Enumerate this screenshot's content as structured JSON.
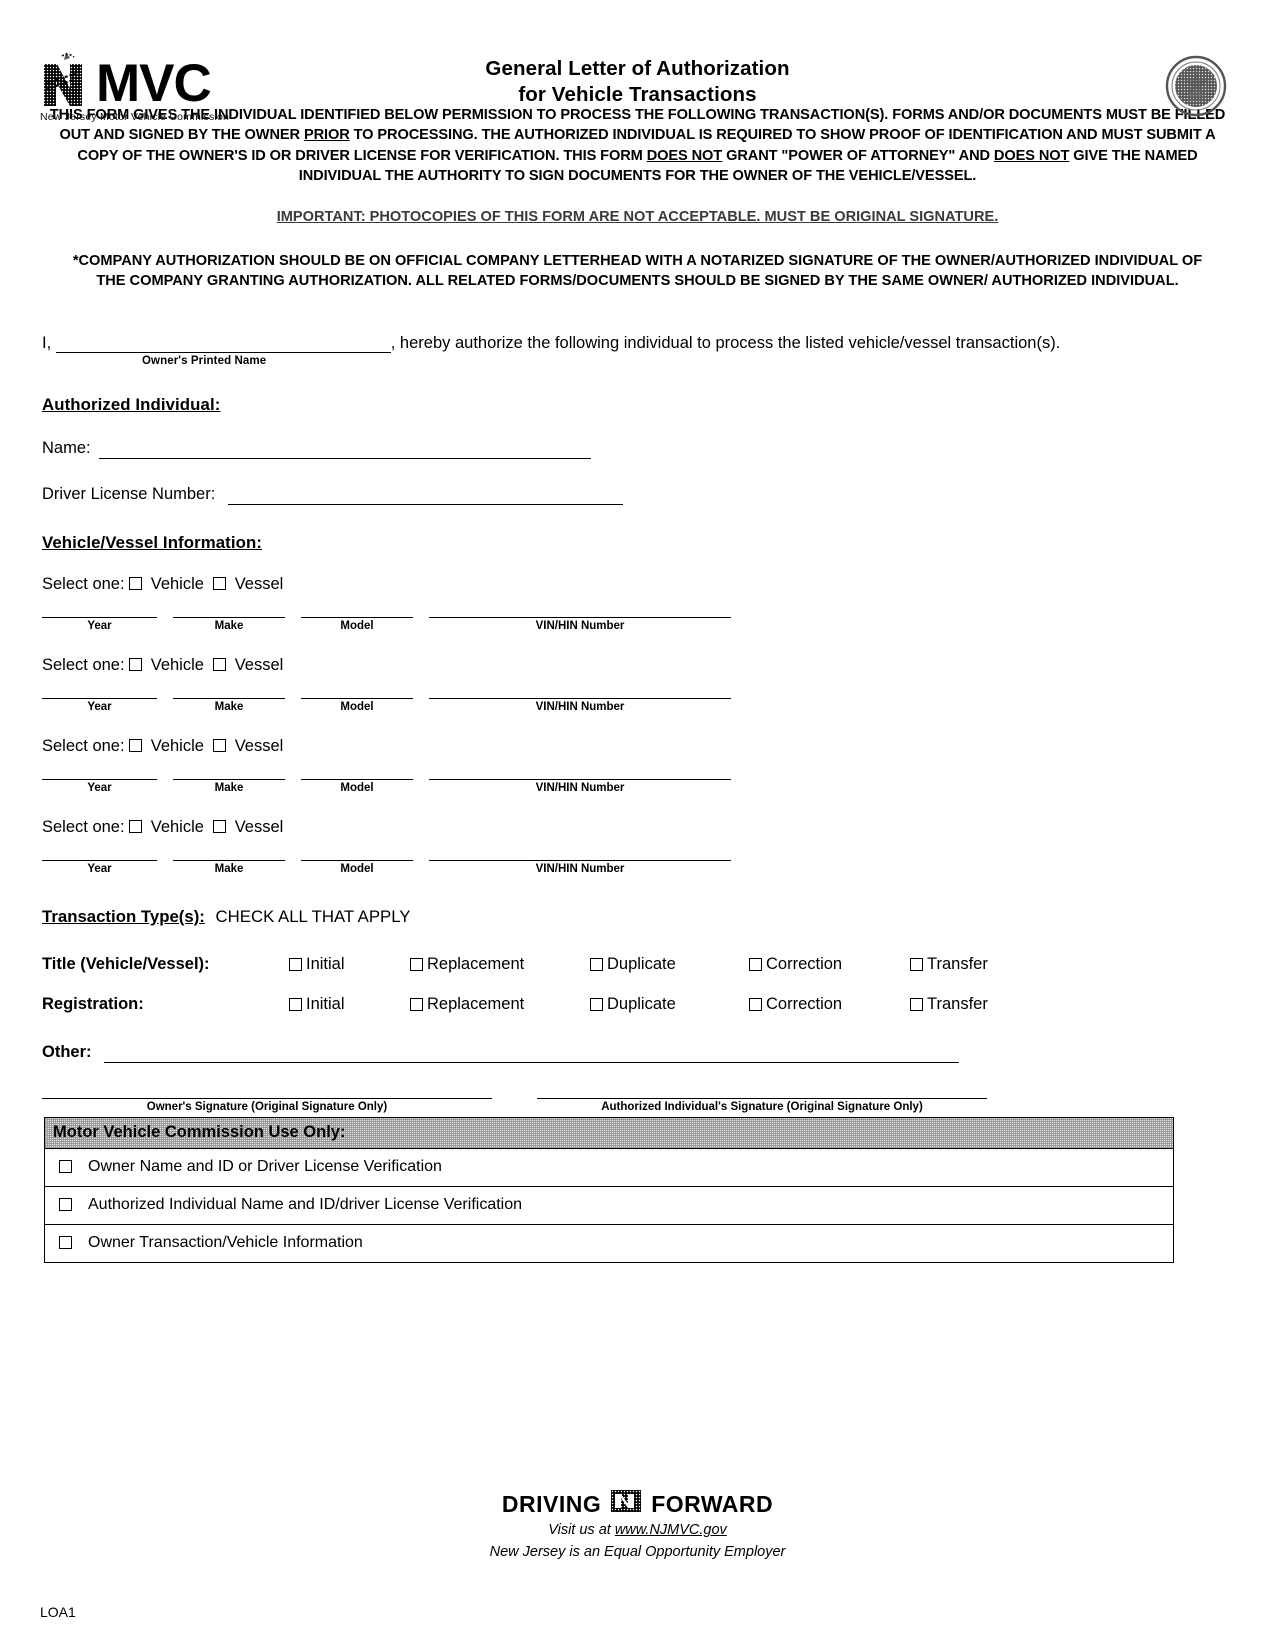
{
  "header": {
    "logo_text": "NJMVC",
    "logo_subtitle": "New Jersey Motor Vehicle Commission",
    "title_line1": "General Letter of Authorization",
    "title_line2": "for Vehicle Transactions",
    "seal_icon": "state-seal-icon"
  },
  "intro": {
    "p1_a": "THIS FORM GIVES THE INDIVIDUAL IDENTIFIED BELOW PERMISSION TO PROCESS THE FOLLOWING TRANSACTION(S). FORMS AND/OR DOCUMENTS MUST BE FILLED OUT AND SIGNED BY THE OWNER ",
    "p1_u1": "PRIOR",
    "p1_b": " TO PROCESSING. THE AUTHORIZED INDIVIDUAL IS REQUIRED TO SHOW PROOF OF IDENTIFICATION AND MUST SUBMIT A COPY OF THE OWNER'S ID OR DRIVER LICENSE FOR VERIFICATION. THIS FORM ",
    "p1_u2": "DOES NOT",
    "p1_c": " GRANT \"POWER OF ATTORNEY\" AND ",
    "p1_u3": "DOES NOT",
    "p1_d": " GIVE THE NAMED INDIVIDUAL THE AUTHORITY TO SIGN DOCUMENTS FOR THE OWNER OF THE VEHICLE/VESSEL.",
    "important": "IMPORTANT: PHOTOCOPIES OF THIS FORM ARE NOT ACCEPTABLE. MUST BE ORIGINAL SIGNATURE.",
    "company": "*COMPANY AUTHORIZATION SHOULD BE ON OFFICIAL COMPANY LETTERHEAD WITH A NOTARIZED SIGNATURE OF THE OWNER/AUTHORIZED INDIVIDUAL OF THE COMPANY GRANTING AUTHORIZATION. ALL RELATED FORMS/DOCUMENTS SHOULD BE SIGNED BY THE SAME OWNER/ AUTHORIZED INDIVIDUAL."
  },
  "authorize_statement": {
    "prefix": "I,",
    "owner_name_value": "",
    "owner_name_caption": "Owner's Printed Name",
    "suffix": ", hereby authorize the following individual to process the listed vehicle/vessel transaction(s)."
  },
  "authorized_individual": {
    "heading": "Authorized Individual:",
    "name_label": "Name:",
    "name_value": "",
    "dl_label": "Driver License Number:",
    "dl_value": ""
  },
  "vehicle_section": {
    "heading": "Vehicle/Vessel Information:",
    "select_label": "Select one:",
    "option_vehicle": "Vehicle",
    "option_vessel": "Vessel",
    "column_labels": [
      "Year",
      "Make",
      "Model",
      "VIN/HIN Number"
    ],
    "entries": [
      {
        "year": "",
        "make": "",
        "model": "",
        "vin": ""
      },
      {
        "year": "",
        "make": "",
        "model": "",
        "vin": ""
      },
      {
        "year": "",
        "make": "",
        "model": "",
        "vin": ""
      },
      {
        "year": "",
        "make": "",
        "model": "",
        "vin": ""
      }
    ]
  },
  "transaction": {
    "heading": "Transaction Type(s):",
    "heading_note": "CHECK ALL THAT APPLY",
    "rows": [
      {
        "label": "Title (Vehicle/Vessel):",
        "options": [
          "Initial",
          "Replacement",
          "Duplicate",
          "Correction",
          "Transfer"
        ]
      },
      {
        "label": "Registration:",
        "options": [
          "Initial",
          "Replacement",
          "Duplicate",
          "Correction",
          "Transfer"
        ]
      }
    ],
    "other_label": "Other:",
    "other_value": ""
  },
  "signatures": {
    "owner_caption": "Owner's Signature (Original Signature Only)",
    "authorized_caption": "Authorized Individual's Signature (Original Signature Only)"
  },
  "mvc_use": {
    "heading": "Motor Vehicle Commission Use Only:",
    "items": [
      "Owner Name and ID or Driver License Verification",
      "Authorized Individual Name and ID/driver License Verification",
      "Owner Transaction/Vehicle Information"
    ]
  },
  "footer": {
    "tagline_left": "DRIVING",
    "tagline_right": "FORWARD",
    "visit_prefix": "Visit us at ",
    "visit_link": "www.NJMVC.gov",
    "eoe": "New Jersey is an Equal Opportunity Employer",
    "form_number": "LOA1"
  }
}
